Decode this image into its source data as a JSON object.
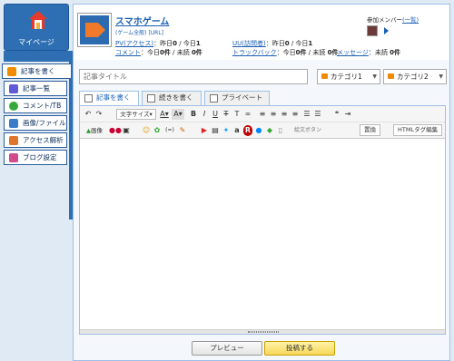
{
  "sidebar": {
    "mypage_label": "マイページ",
    "items": [
      {
        "label": "記事を書く",
        "icon": "pencil-icon",
        "color": "#f08a00"
      },
      {
        "label": "記事一覧",
        "icon": "list-icon",
        "color": "#5f5ad6"
      },
      {
        "label": "コメント/TB",
        "icon": "comment-icon",
        "color": "#37a93a"
      },
      {
        "label": "画像/ファイル",
        "icon": "image-icon",
        "color": "#3a7cc9"
      },
      {
        "label": "アクセス解析",
        "icon": "chart-icon",
        "color": "#e0742a"
      },
      {
        "label": "ブログ設定",
        "icon": "wrench-icon",
        "color": "#d14a8a"
      }
    ]
  },
  "header": {
    "title": "スマホゲーム",
    "link1": "(ゲーム全般)",
    "link2": "[URL]",
    "pv_label": "PV(アクセス)",
    "pv_text": "：昨日",
    "pv_y": "0",
    "pv_sep": "/ 今日",
    "pv_t": "1",
    "uu_label": "UU(訪問者)",
    "uu_text": "：昨日",
    "uu_y": "0",
    "uu_sep": "/ 今日",
    "uu_t": "1",
    "comment_label": "コメント",
    "comment_text": "：今日",
    "comment_today": "0件",
    "comment_unread": "/ 未読",
    "comment_unread_v": "0件",
    "tb_label": "トラックバック",
    "tb_text": "：今日",
    "tb_today": "0件",
    "tb_unread": "/ 未読",
    "tb_unread_v": "0件",
    "msg_label": "メッセージ",
    "msg_text": "：未読",
    "msg_v": "0件",
    "members_label": "参加メンバー",
    "members_link": "(一覧)"
  },
  "form": {
    "title_placeholder": "記事タイトル",
    "category1": "カテゴリ1",
    "category2": "カテゴリ2"
  },
  "tabs": [
    "記事を書く",
    "続きを書く",
    "プライベート"
  ],
  "toolbar": {
    "fontsize": "文字サイズ",
    "image_label": "画像",
    "button_label": "絵文ボタン",
    "replace": "置換",
    "html_edit": "HTMLタグ編集"
  },
  "buttons": {
    "preview": "プレビュー",
    "post": "投稿する"
  }
}
